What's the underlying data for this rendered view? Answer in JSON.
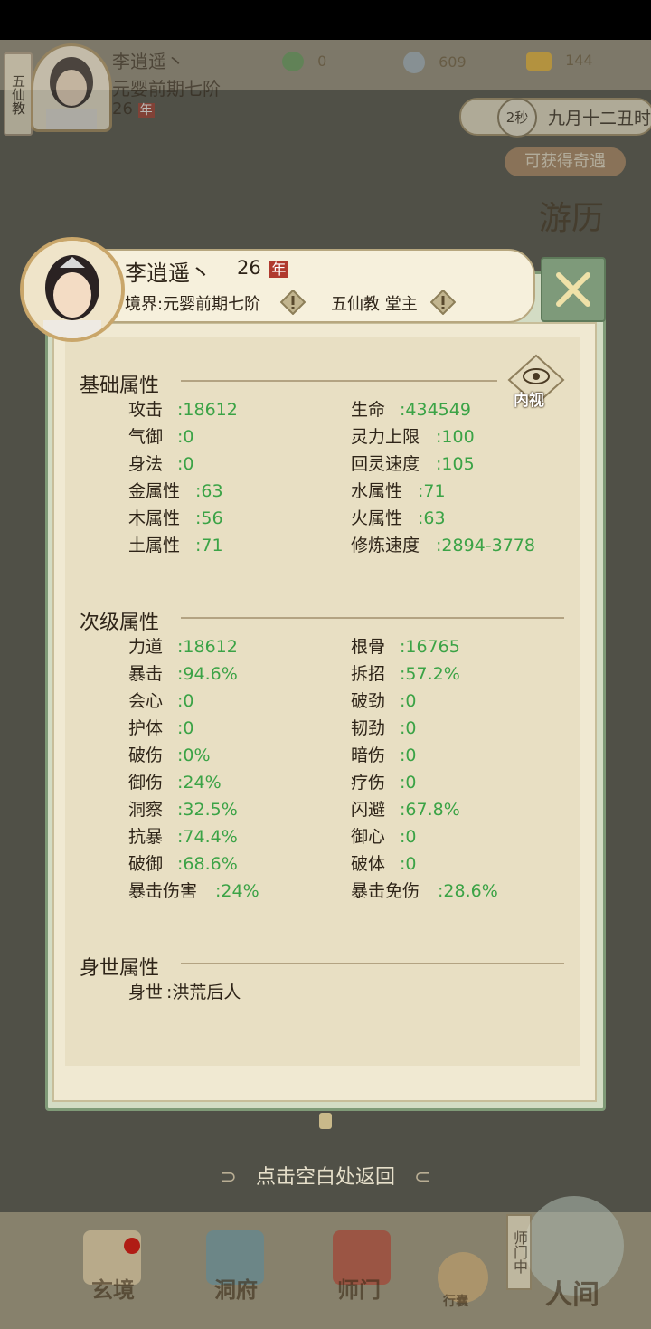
{
  "header": {
    "sect_short": "五仙教",
    "player_name": "李逍遥丶",
    "realm": "元婴前期七阶",
    "age": "26",
    "age_unit": "年",
    "resources": [
      {
        "icon": "jade-eye-icon",
        "value": "0"
      },
      {
        "icon": "coin-icon",
        "value": "609"
      },
      {
        "icon": "ingot-icon",
        "value": "144"
      }
    ],
    "timer": "2秒",
    "date": "九月十二丑时",
    "qiyu_button": "可获得奇遇",
    "side_label": "游历"
  },
  "card": {
    "name": "李逍遥丶",
    "age": "26",
    "age_unit": "年",
    "realm_label": "境界:元婴前期七阶",
    "sect_label": "五仙教 堂主",
    "eye_button": "内视",
    "sections": [
      {
        "title": "基础属性",
        "rows": [
          [
            {
              "k": "攻击",
              "v": ":18612"
            },
            {
              "k": "生命",
              "v": ":434549"
            }
          ],
          [
            {
              "k": "气御",
              "v": ":0"
            },
            {
              "k": "灵力上限",
              "v": ":100"
            }
          ],
          [
            {
              "k": "身法",
              "v": ":0"
            },
            {
              "k": "回灵速度",
              "v": ":105"
            }
          ],
          [
            {
              "k": "金属性",
              "v": ":63"
            },
            {
              "k": "水属性",
              "v": ":71"
            }
          ],
          [
            {
              "k": "木属性",
              "v": ":56"
            },
            {
              "k": "火属性",
              "v": ":63"
            }
          ],
          [
            {
              "k": "土属性",
              "v": ":71"
            },
            {
              "k": "修炼速度",
              "v": ":2894-3778"
            }
          ]
        ]
      },
      {
        "title": "次级属性",
        "rows": [
          [
            {
              "k": "力道",
              "v": ":18612"
            },
            {
              "k": "根骨",
              "v": ":16765"
            }
          ],
          [
            {
              "k": "暴击",
              "v": ":94.6%"
            },
            {
              "k": "拆招",
              "v": ":57.2%"
            }
          ],
          [
            {
              "k": "会心",
              "v": ":0"
            },
            {
              "k": "破劲",
              "v": ":0"
            }
          ],
          [
            {
              "k": "护体",
              "v": ":0"
            },
            {
              "k": "韧劲",
              "v": ":0"
            }
          ],
          [
            {
              "k": "破伤",
              "v": ":0%"
            },
            {
              "k": "暗伤",
              "v": ":0"
            }
          ],
          [
            {
              "k": "御伤",
              "v": ":24%"
            },
            {
              "k": "疗伤",
              "v": ":0"
            }
          ],
          [
            {
              "k": "洞察",
              "v": ":32.5%"
            },
            {
              "k": "闪避",
              "v": ":67.8%"
            }
          ],
          [
            {
              "k": "抗暴",
              "v": ":74.4%"
            },
            {
              "k": "御心",
              "v": ":0"
            }
          ],
          [
            {
              "k": "破御",
              "v": ":68.6%"
            },
            {
              "k": "破体",
              "v": ":0"
            }
          ],
          [
            {
              "k": "暴击伤害",
              "v": ":24%"
            },
            {
              "k": "暴击免伤",
              "v": ":28.6%"
            }
          ]
        ]
      },
      {
        "title": "身世属性",
        "rows": [
          [
            {
              "k": "身世",
              "v": ":洪荒后人"
            }
          ]
        ]
      }
    ]
  },
  "return_hint": "点击空白处返回",
  "nav": {
    "items": [
      "玄境",
      "洞府",
      "师门",
      "行囊",
      "人间"
    ],
    "badge_text": "师门中"
  },
  "colors": {
    "value_green": "#3ba346",
    "frame_green": "#7f9a77",
    "paper": "#e8dfc3"
  }
}
